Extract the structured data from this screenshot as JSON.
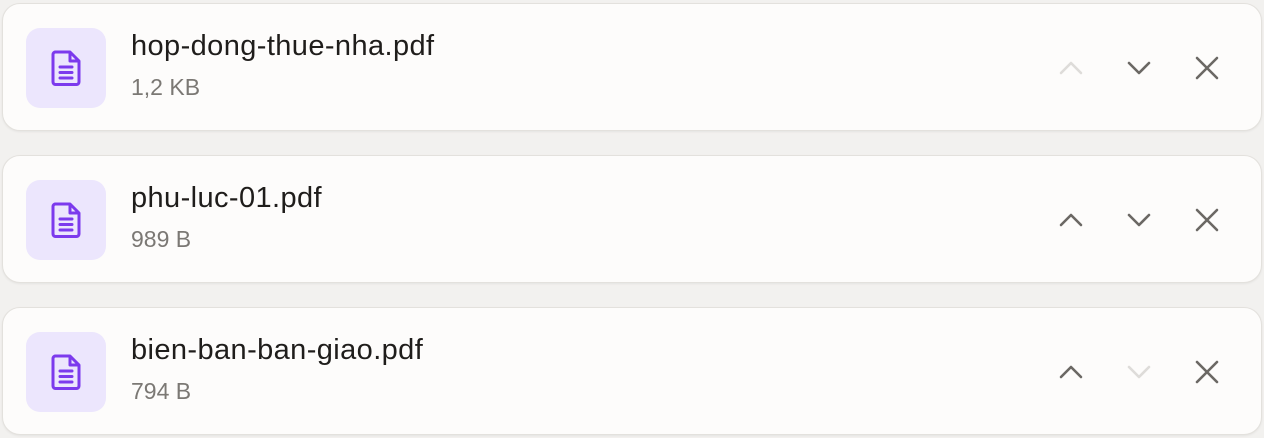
{
  "files": [
    {
      "name": "hop-dong-thue-nha.pdf",
      "size": "1,2 KB",
      "icon": "document-icon",
      "can_move_up": false,
      "can_move_down": true
    },
    {
      "name": "phu-luc-01.pdf",
      "size": "989 B",
      "icon": "document-icon",
      "can_move_up": true,
      "can_move_down": true
    },
    {
      "name": "bien-ban-ban-giao.pdf",
      "size": "794 B",
      "icon": "document-icon",
      "can_move_up": true,
      "can_move_down": false
    }
  ],
  "actions": {
    "move_up_icon": "chevron-up-icon",
    "move_down_icon": "chevron-down-icon",
    "remove_icon": "close-icon"
  },
  "colors": {
    "icon_accent": "#7c3aed",
    "icon_background": "#ece6fd",
    "action_enabled": "#6b6864",
    "action_disabled": "#d6d4d1"
  }
}
